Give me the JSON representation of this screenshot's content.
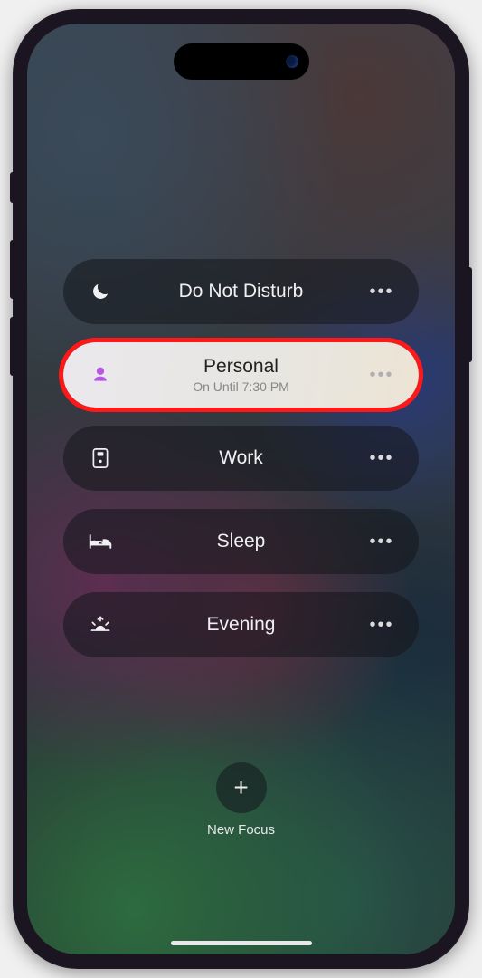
{
  "focus_modes": [
    {
      "id": "dnd",
      "label": "Do Not Disturb",
      "subtitle": "",
      "active": false,
      "icon": "moon"
    },
    {
      "id": "personal",
      "label": "Personal",
      "subtitle": "On Until 7:30 PM",
      "active": true,
      "icon": "person"
    },
    {
      "id": "work",
      "label": "Work",
      "subtitle": "",
      "active": false,
      "icon": "badge"
    },
    {
      "id": "sleep",
      "label": "Sleep",
      "subtitle": "",
      "active": false,
      "icon": "bed"
    },
    {
      "id": "evening",
      "label": "Evening",
      "subtitle": "",
      "active": false,
      "icon": "sunset"
    }
  ],
  "new_focus": {
    "label": "New Focus",
    "glyph": "+"
  },
  "more_glyph": "•••",
  "highlighted": "personal"
}
